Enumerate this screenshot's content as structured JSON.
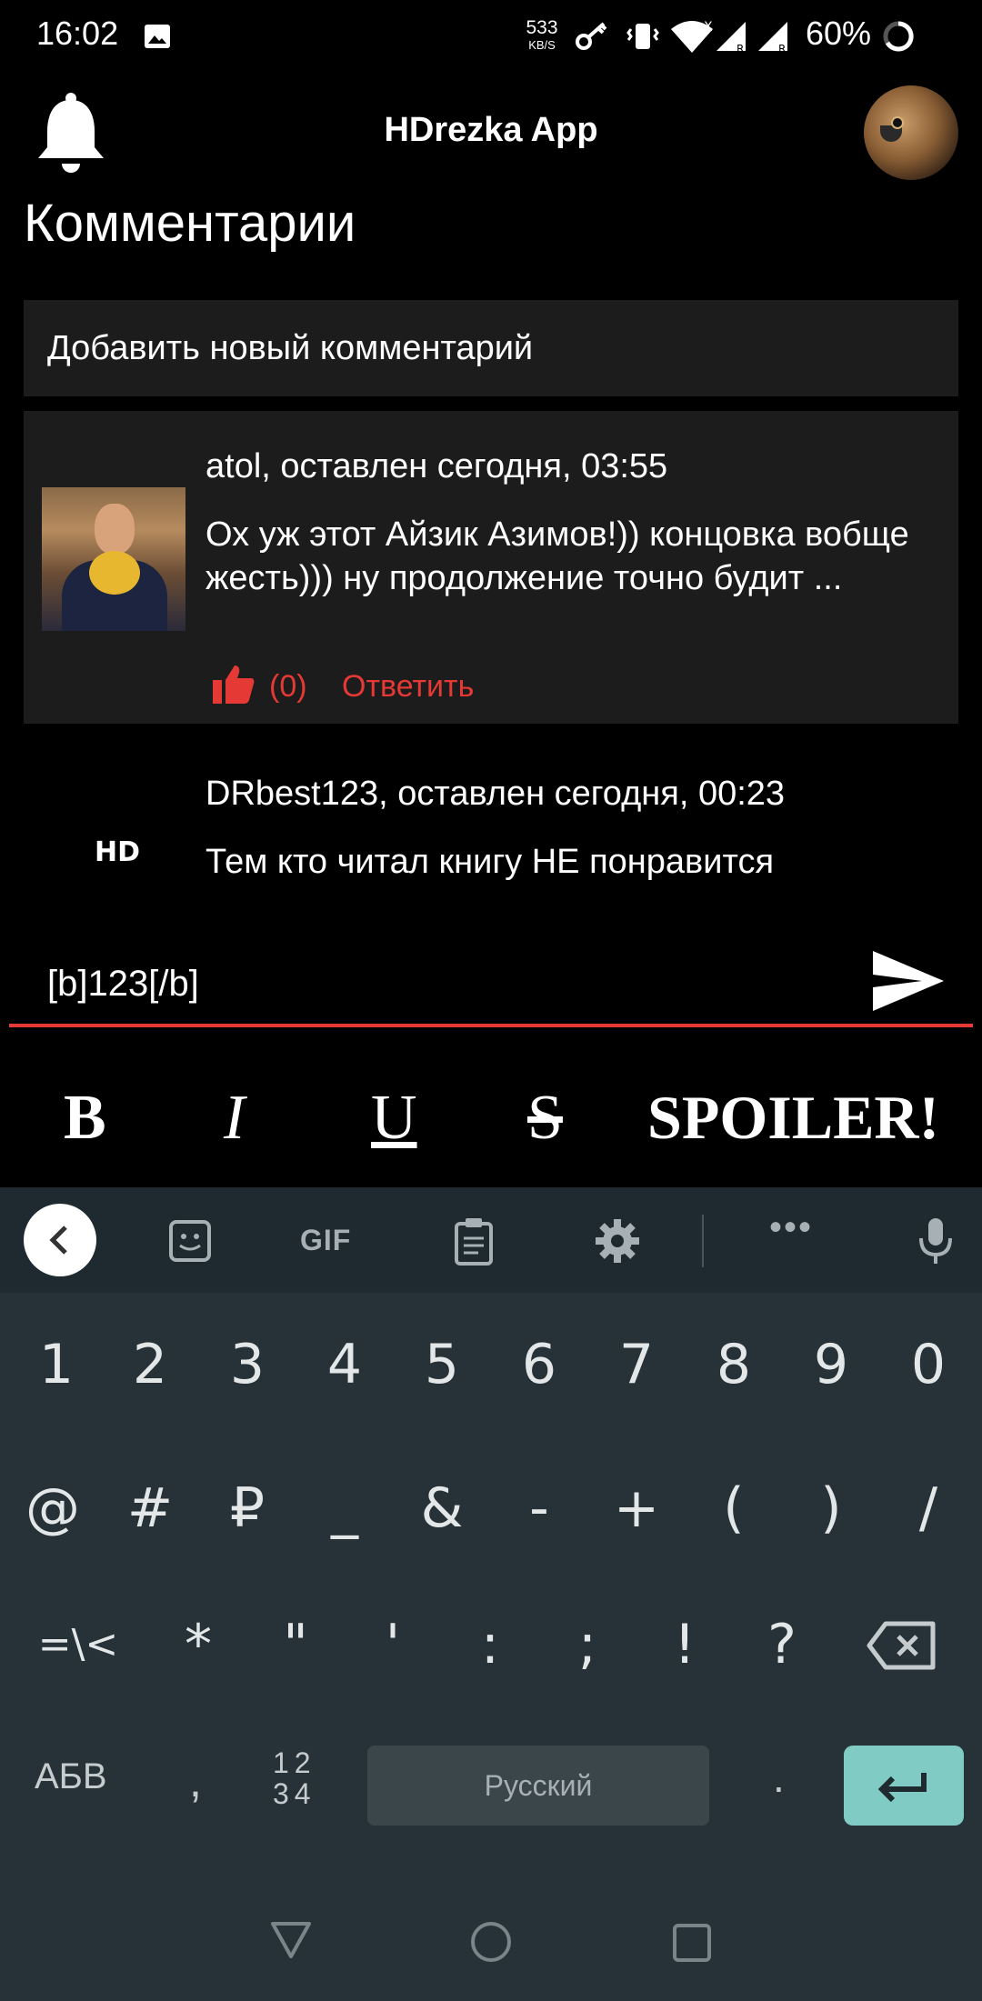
{
  "status_bar": {
    "time": "16:02",
    "speed_value": "533",
    "speed_unit": "KB/S",
    "battery": "60%"
  },
  "app": {
    "title": "HDrezka App"
  },
  "page": {
    "title": "Комментарии",
    "add_comment": "Добавить новый комментарий"
  },
  "comments": [
    {
      "meta": "atol, оставлен сегодня, 03:55",
      "text": "Ох уж этот Айзик Азимов!)) концовка вобще жесть))) ну продолжение точно будит ...",
      "likes": "(0)",
      "reply": "Ответить"
    },
    {
      "avatar_label": "HD",
      "meta": "DRbest123, оставлен сегодня, 00:23",
      "text": "Тем кто читал книгу НЕ понравится"
    }
  ],
  "input": {
    "value": "[b]123[/b]"
  },
  "format_toolbar": {
    "bold": "B",
    "italic": "I",
    "underline": "U",
    "strike": "S",
    "spoiler": "SPOILER!"
  },
  "keyboard": {
    "gif_label": "GIF",
    "dots": "•••",
    "row1": [
      "1",
      "2",
      "3",
      "4",
      "5",
      "6",
      "7",
      "8",
      "9",
      "0"
    ],
    "row2": [
      "@",
      "#",
      "₽",
      "_",
      "&",
      "-",
      "+",
      "(",
      ")",
      "/"
    ],
    "row3": [
      "=\\<",
      "*",
      "\"",
      "'",
      ":",
      ";",
      "!",
      "?"
    ],
    "abv": "АБВ",
    "comma": ",",
    "num_top": "12",
    "num_bottom": "34",
    "space_label": "Русский",
    "period": "."
  },
  "colors": {
    "accent": "#e53935",
    "card_bg": "#1c1c1c",
    "keyboard_bg": "#263238",
    "enter_key": "#80cbc4"
  }
}
